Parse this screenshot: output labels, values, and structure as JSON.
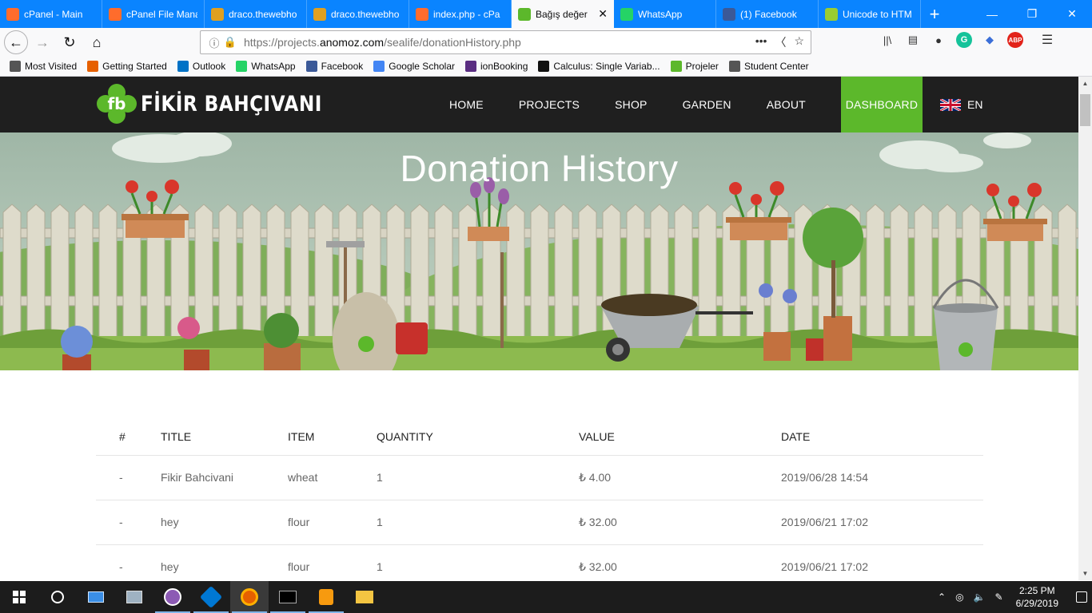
{
  "browser": {
    "tabs": [
      {
        "title": "cPanel - Main",
        "icon": "cpanel-icon",
        "color": "#ff6c2c"
      },
      {
        "title": "cPanel File Mana",
        "icon": "cpanel-icon",
        "color": "#ff6c2c"
      },
      {
        "title": "draco.thewebho",
        "icon": "webhost-icon",
        "color": "#e0a020"
      },
      {
        "title": "draco.thewebho",
        "icon": "webhost-icon",
        "color": "#e0a020"
      },
      {
        "title": "index.php - cPa",
        "icon": "cpanel-icon",
        "color": "#ff6c2c"
      },
      {
        "title": "Bağış değer",
        "icon": "fb-icon",
        "color": "#5cb82b",
        "active": true
      },
      {
        "title": "WhatsApp",
        "icon": "whatsapp-icon",
        "color": "#25d366"
      },
      {
        "title": "(1) Facebook",
        "icon": "facebook-icon",
        "color": "#3b5998"
      },
      {
        "title": "Unicode to HTM",
        "icon": "unicode-icon",
        "color": "#9acd32"
      }
    ],
    "url_prefix": "https://projects.",
    "url_domain": "anomoz.com",
    "url_path": "/sealife/donationHistory.php",
    "bookmarks": [
      {
        "label": "Most Visited",
        "icon": "gear-icon",
        "color": "#555555"
      },
      {
        "label": "Getting Started",
        "icon": "firefox-icon",
        "color": "#e66000"
      },
      {
        "label": "Outlook",
        "icon": "outlook-icon",
        "color": "#0072c6"
      },
      {
        "label": "WhatsApp",
        "icon": "whatsapp-icon",
        "color": "#25d366"
      },
      {
        "label": "Facebook",
        "icon": "facebook-icon",
        "color": "#3b5998"
      },
      {
        "label": "Google Scholar",
        "icon": "scholar-icon",
        "color": "#4285f4"
      },
      {
        "label": "ionBooking",
        "icon": "ionbooking-icon",
        "color": "#5a2d82"
      },
      {
        "label": "Calculus: Single Variab...",
        "icon": "calculus-icon",
        "color": "#111111"
      },
      {
        "label": "Projeler",
        "icon": "fb-icon",
        "color": "#5cb82b"
      },
      {
        "label": "Student Center",
        "icon": "globe-icon",
        "color": "#555555"
      }
    ]
  },
  "site": {
    "logo_mark": "fb",
    "logo_text": "FİKİR BAHÇIVANI",
    "nav": [
      "HOME",
      "PROJECTS",
      "SHOP",
      "GARDEN",
      "ABOUT"
    ],
    "dashboard": "DASHBOARD",
    "lang": "EN",
    "brand_color": "#5cb82b",
    "header_color": "#1f1f1f"
  },
  "banner": {
    "title": "Donation History"
  },
  "history": {
    "columns": [
      "#",
      "TITLE",
      "ITEM",
      "QUANTITY",
      "VALUE",
      "DATE"
    ],
    "rows": [
      [
        "-",
        "Fikir Bahcivani",
        "wheat",
        "1",
        "₺ 4.00",
        "2019/06/28 14:54"
      ],
      [
        "-",
        "hey",
        "flour",
        "1",
        "₺ 32.00",
        "2019/06/21 17:02"
      ],
      [
        "-",
        "hey",
        "flour",
        "1",
        "₺ 32.00",
        "2019/06/21 17:02"
      ]
    ]
  },
  "taskbar": {
    "time": "2:25 PM",
    "date": "6/29/2019"
  }
}
